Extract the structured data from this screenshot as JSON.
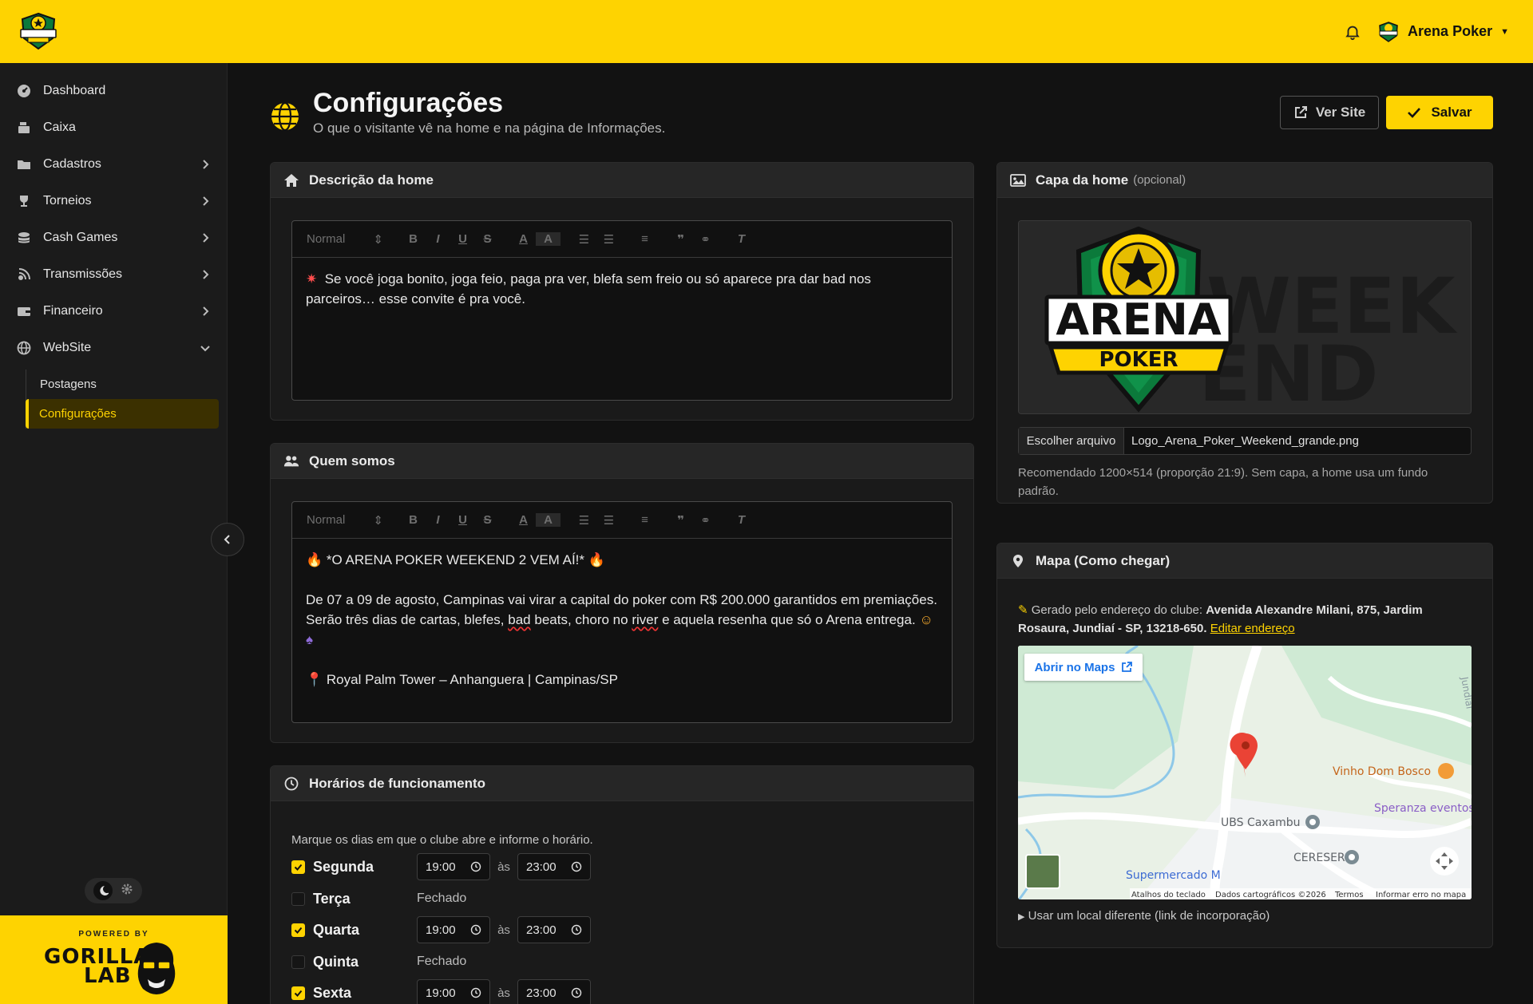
{
  "brand": {
    "name": "Arena Poker",
    "accent": "#fed301"
  },
  "topbar": {
    "user_label": "Arena Poker"
  },
  "sidebar": {
    "items": [
      {
        "label": "Dashboard",
        "icon": "gauge-icon"
      },
      {
        "label": "Caixa",
        "icon": "cash-register-icon"
      },
      {
        "label": "Cadastros",
        "icon": "folder-icon"
      },
      {
        "label": "Torneios",
        "icon": "trophy-icon"
      },
      {
        "label": "Cash Games",
        "icon": "coins-icon"
      },
      {
        "label": "Transmissões",
        "icon": "broadcast-icon"
      },
      {
        "label": "Financeiro",
        "icon": "wallet-icon"
      },
      {
        "label": "WebSite",
        "icon": "globe-icon"
      }
    ],
    "sub_items": [
      {
        "label": "Postagens"
      },
      {
        "label": "Configurações"
      }
    ],
    "powered_by": "POWERED BY",
    "powered_brand_line1": "GORILLA",
    "powered_brand_line2": "LAB"
  },
  "page": {
    "title": "Configurações",
    "subtitle": "O que o visitante vê na home e na página de Informações.",
    "view_site_label": "Ver Site",
    "save_label": "Salvar"
  },
  "editor_toolbar": {
    "format_label": "Normal"
  },
  "home_description": {
    "title": "Descrição da home",
    "paragraphs": [
      "Se você joga bonito, joga feio, paga pra ver, blefa sem freio ou só aparece pra dar bad nos parceiros… esse convite é pra você."
    ]
  },
  "about": {
    "title": "Quem somos",
    "line1": "*O ARENA POKER WEEKEND 2 VEM AÍ!*",
    "line2": "De 07 a 09 de agosto, Campinas vai virar a capital do poker com R$ 200.000 garantidos em premiações.",
    "line3a": "Serão três dias de cartas, blefes,",
    "line3b": "bad",
    "line3c": "beats, choro no",
    "line3d": "river",
    "line3e": "e aquela resenha que só o Arena entrega.",
    "line4": "Royal Palm Tower – Anhanguera | Campinas/SP"
  },
  "hours": {
    "title": "Horários de funcionamento",
    "intro": "Marque os dias em que o clube abre e informe o horário.",
    "separator": "às",
    "closed_label": "Fechado",
    "days": [
      {
        "name": "Segunda",
        "open": true,
        "start": "19:00",
        "end": "23:00"
      },
      {
        "name": "Terça",
        "open": false
      },
      {
        "name": "Quarta",
        "open": true,
        "start": "19:00",
        "end": "23:00"
      },
      {
        "name": "Quinta",
        "open": false
      },
      {
        "name": "Sexta",
        "open": true,
        "start": "19:00",
        "end": "23:00"
      }
    ]
  },
  "cover": {
    "title": "Capa da home",
    "optional": "(opcional)",
    "logo_line1": "ARENA",
    "logo_line2": "POKER",
    "bg_text1": "WEEK",
    "bg_text2": "END",
    "file_button": "Escolher arquivo",
    "file_name": "Logo_Arena_Poker_Weekend_grande.png",
    "help": "Recomendado 1200×514 (proporção 21:9). Sem capa, a home usa um fundo padrão."
  },
  "map": {
    "title": "Mapa (Como chegar)",
    "generated_prefix": "Gerado pelo endereço do clube:",
    "address": "Avenida Alexandre Milani, 875, Jardim Rosaura, Jundiaí - SP, 13218-650.",
    "edit_link": "Editar endereço",
    "open_maps": "Abrir no Maps",
    "places": {
      "vinho": "Vinho Dom Bosco",
      "speranza": "Speranza eventos",
      "ubs": "UBS Caxambu",
      "cereser": "CERESER",
      "supermercado": "Supermercado M",
      "jundiai": "Jundiaí"
    },
    "footer": {
      "shortcuts": "Atalhos do teclado",
      "data": "Dados cartográficos ©2026",
      "terms": "Termos",
      "report": "Informar erro no mapa"
    },
    "other_location": "Usar um local diferente (link de incorporação)"
  }
}
